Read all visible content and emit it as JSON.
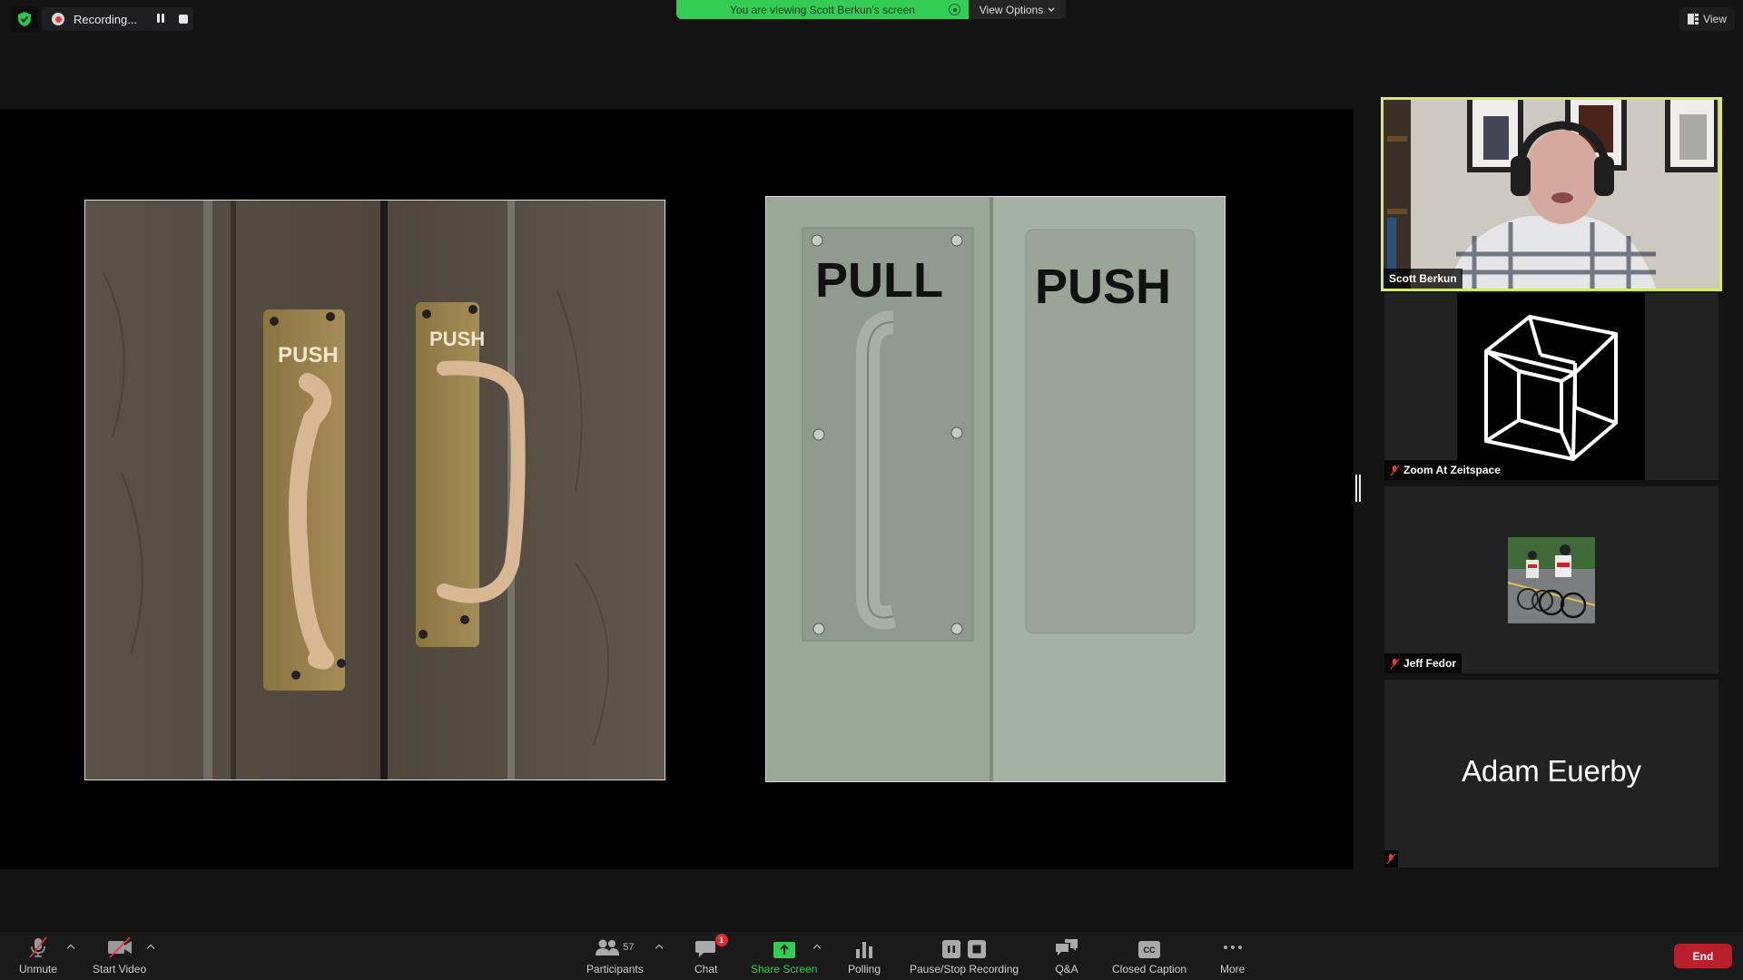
{
  "top_bar": {
    "recording_label": "Recording...",
    "banner_text": "You are viewing Scott Berkun's screen",
    "view_options_label": "View Options",
    "view_label": "View"
  },
  "shared_screen": {
    "sharer": "Scott Berkun",
    "left_image": {
      "description": "wooden double doors with brass pull handles",
      "sign_text": [
        "PUSH",
        "PUSH"
      ]
    },
    "right_image": {
      "description": "door with pull handle plate and flat push plate",
      "sign_text": [
        "PULL",
        "PUSH"
      ]
    }
  },
  "participants_panel": {
    "tiles": [
      {
        "name": "Scott Berkun",
        "active_speaker": true,
        "video_on": true,
        "muted": false
      },
      {
        "name": "Zoom At Zeitspace",
        "active_speaker": false,
        "video_on": true,
        "muted": true
      },
      {
        "name": "Jeff Fedor",
        "active_speaker": false,
        "video_on": false,
        "muted": true,
        "avatar": "cyclists photo"
      },
      {
        "name": "Adam Euerby",
        "active_speaker": false,
        "video_on": false,
        "muted": true
      }
    ]
  },
  "toolbar": {
    "unmute_label": "Unmute",
    "start_video_label": "Start Video",
    "participants_label": "Participants",
    "participants_count": "57",
    "chat_label": "Chat",
    "chat_badge": "1",
    "share_screen_label": "Share Screen",
    "polling_label": "Polling",
    "recording_label": "Pause/Stop Recording",
    "qa_label": "Q&A",
    "cc_label": "Closed Caption",
    "cc_glyph": "CC",
    "more_label": "More",
    "end_label": "End"
  },
  "colors": {
    "share_green": "#33cc55",
    "active_speaker_border": "#d8e86a",
    "end_red": "#b81f2b",
    "record_red": "#f0373a"
  }
}
